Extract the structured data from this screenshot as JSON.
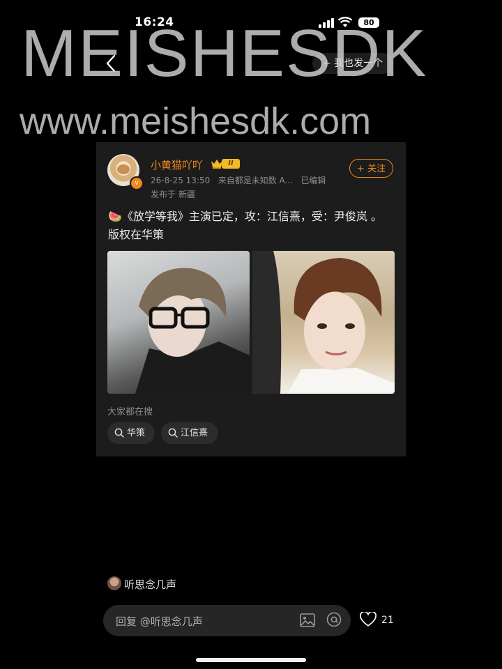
{
  "status_bar": {
    "time": "16:24",
    "battery": "80"
  },
  "watermark": {
    "title": "MEISHESDK",
    "url": "www.meishesdk.com"
  },
  "nav": {
    "back_icon": "chevron-left-icon",
    "action_label": "+ 我也发一个"
  },
  "post": {
    "author": "小黄猫吖吖",
    "level": "II",
    "timestamp": "26-8-25 13:50",
    "source": "来自都是未知数 A...",
    "edited": "已编辑",
    "location": "发布于 新疆",
    "follow_label": "+ 关注",
    "text": "🍉《放学等我》主演已定，攻：江信熹，受：尹俊岚 。版权在华策"
  },
  "trending": {
    "label": "大家都在搜",
    "tags": [
      "华策",
      "江信熹"
    ]
  },
  "reply": {
    "username": "听思念几声",
    "placeholder": "回复 @听思念几声",
    "like_count": "21"
  },
  "colors": {
    "accent": "#f08a1c",
    "background": "#000000",
    "card": "#1c1c1c"
  }
}
